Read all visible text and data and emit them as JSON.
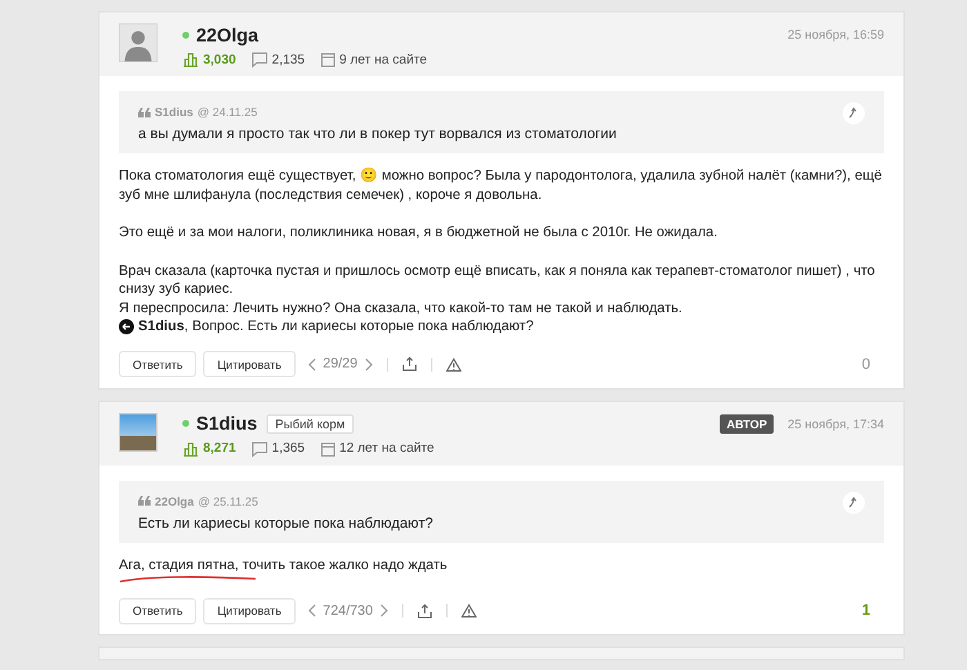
{
  "comments": [
    {
      "avatar": {
        "kind": "silhouette"
      },
      "online": true,
      "author": "22Olga",
      "rating": "3,030",
      "comments_count": "2,135",
      "tenure": "9 лет на сайте",
      "time": "25 ноября, 16:59",
      "quote": {
        "author": "S1dius",
        "date": "@ 24.11.25",
        "text": "а вы думали я просто так что ли в покер тут ворвался из стоматологии"
      },
      "paragraphs": [
        {
          "kind": "text",
          "text": "Пока стоматология ещё существует, 🙂 можно вопрос? Была у пародонтолога, удалила  зубной налёт (камни?), ещё зуб мне шлифанула (последствия семечек) , короче я довольна."
        },
        {
          "kind": "gap"
        },
        {
          "kind": "text",
          "text": "Это ещё и за мои налоги, поликлиника новая, я в бюджетной не была с 2010г. Не ожидала."
        },
        {
          "kind": "gap"
        },
        {
          "kind": "text",
          "text": "Врач сказала (карточка пустая и пришлось осмотр ещё вписать, как я поняла как терапевт-стоматолог пишет) , что снизу зуб кариес."
        },
        {
          "kind": "text",
          "text": "Я переспросила: Лечить нужно? Она сказала, что какой-то там не такой и наблюдать."
        },
        {
          "kind": "mention",
          "text": "**S1dius**, Вопрос. Есть ли кариесы которые пока наблюдают?"
        }
      ],
      "underline": false,
      "reply": "Ответить",
      "cite": "Цитировать",
      "position": "29/29",
      "votes": "0",
      "votes_positive": false
    },
    {
      "avatar": {
        "kind": "photo"
      },
      "online": true,
      "author": "S1dius",
      "rank": "Рыбий корм",
      "author_badge": "АВТОР",
      "rating": "8,271",
      "comments_count": "1,365",
      "tenure": "12 лет на сайте",
      "time": "25 ноября, 17:34",
      "quote": {
        "author": "22Olga",
        "date": "@ 25.11.25",
        "text": "Есть ли кариесы которые пока наблюдают?"
      },
      "paragraphs": [
        {
          "kind": "text",
          "text": "Ага, стадия пятна, точить такое жалко надо ждать"
        }
      ],
      "underline": true,
      "reply": "Ответить",
      "cite": "Цитировать",
      "position": "724/730",
      "votes": "1",
      "votes_positive": true
    }
  ]
}
